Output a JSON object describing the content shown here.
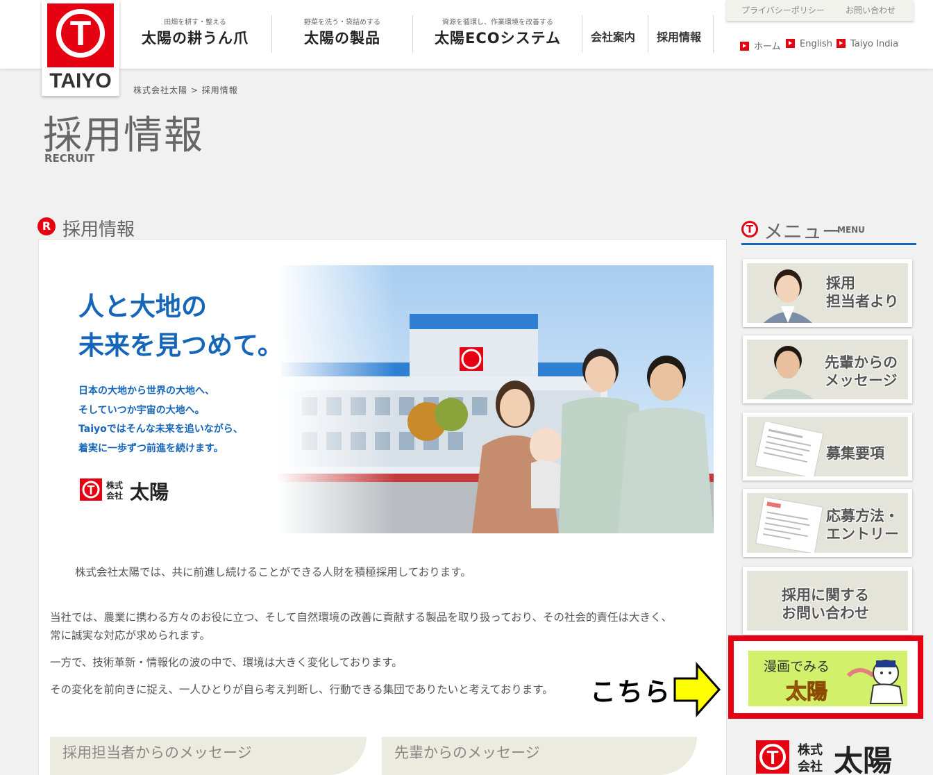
{
  "header": {
    "logo_text": "TAIYO",
    "logo_letter": "T",
    "nav": [
      {
        "sub": "田畑を耕す・整える",
        "label": "太陽の耕うん爪"
      },
      {
        "sub": "野菜を洗う・袋詰めする",
        "label": "太陽の製品"
      },
      {
        "sub": "資源を循環し、作業環境を改善する",
        "label": "太陽ECOシステム"
      }
    ],
    "nav_simple": [
      "会社案内",
      "採用情報"
    ],
    "utility": [
      "プライバシーポリシー",
      "お問い合わせ"
    ],
    "lang": [
      "ホーム",
      "English",
      "Taiyo India"
    ]
  },
  "breadcrumb": {
    "home": "株式会社太陽",
    "sep": " > ",
    "current": "採用情報"
  },
  "page": {
    "title": "採用情報",
    "title_en": "RECRUIT"
  },
  "section": {
    "icon": "R",
    "title": "採用情報"
  },
  "hero": {
    "title_line1": "人と大地の",
    "title_line2": "未来を見つめて。",
    "body": [
      "日本の大地から世界の大地へ、",
      "そしていつか宇宙の大地へ。",
      "Taiyoではそんな未来を追いながら、",
      "着実に一歩ずつ前進を続けます。"
    ],
    "brand_small1": "株式",
    "brand_small2": "会社",
    "brand_name": "太陽"
  },
  "body": {
    "lead": "株式会社太陽では、共に前進し続けることができる人財を積極採用しております。",
    "p1_line1": "当社では、農業に携わる方々のお役に立つ、そして自然環境の改善に貢献する製品を取り扱っており、その社会的責任は大きく、",
    "p1_line2": "常に誠実な対応が求められます。",
    "p2": "一方で、技術革新・情報化の波の中で、環境は大きく変化しております。",
    "p3": "その変化を前向きに捉え、一人ひとりが自ら考え判断し、行動できる集団でありたいと考えております。"
  },
  "callout": {
    "label": "こちら",
    "arrow_color": "#ffff00"
  },
  "bottom_tabs": [
    "採用担当者からのメッセージ",
    "先輩からのメッセージ"
  ],
  "sidebar": {
    "menu_icon": "T",
    "menu_jp": "メニュー",
    "menu_en": "MENU",
    "items": [
      {
        "line1": "採用",
        "line2": "担当者より"
      },
      {
        "line1": "先輩からの",
        "line2": "メッセージ"
      },
      {
        "line1": "募集要項",
        "line2": ""
      },
      {
        "line1": "応募方法・",
        "line2": "エントリー"
      },
      {
        "line1": "採用に関する",
        "line2": "お問い合わせ"
      }
    ],
    "manga_line1": "漫画でみる",
    "manga_line2": "太陽",
    "corp_small1": "株式",
    "corp_small2": "会社",
    "corp_name": "太陽"
  },
  "colors": {
    "brand_red": "#e50012",
    "brand_blue": "#1565b8",
    "highlight": "#e50012",
    "manga_bg": "#d2f06a"
  }
}
